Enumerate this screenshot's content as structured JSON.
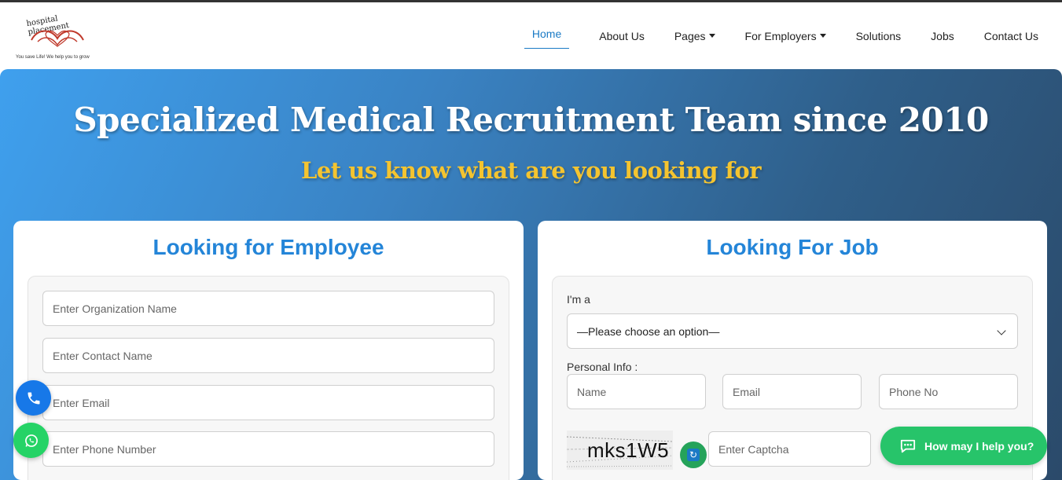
{
  "logo": {
    "title": "hospital placement",
    "tagline": "You save Life! We help you to grow"
  },
  "nav": {
    "items": [
      {
        "label": "Home",
        "active": true,
        "dropdown": false
      },
      {
        "label": "About Us",
        "active": false,
        "dropdown": false
      },
      {
        "label": "Pages",
        "active": false,
        "dropdown": true
      },
      {
        "label": "For Employers",
        "active": false,
        "dropdown": true
      },
      {
        "label": "Solutions",
        "active": false,
        "dropdown": false
      },
      {
        "label": "Jobs",
        "active": false,
        "dropdown": false
      },
      {
        "label": "Contact Us",
        "active": false,
        "dropdown": false
      }
    ]
  },
  "hero": {
    "title": "Specialized Medical Recruitment Team since 2010",
    "subtitle": "Let us know what are you looking for"
  },
  "employee_form": {
    "title": "Looking for Employee",
    "org_placeholder": "Enter Organization Name",
    "contact_placeholder": "Enter Contact Name",
    "email_placeholder": "Enter Email",
    "phone_placeholder": "Enter Phone Number"
  },
  "job_form": {
    "title": "Looking For Job",
    "role_label": "I'm a",
    "role_select_value": "—Please choose an option—",
    "personal_label": "Personal Info :",
    "name_placeholder": "Name",
    "email_placeholder": "Email",
    "phone_placeholder": "Phone No",
    "captcha_text": "mks1W5",
    "captcha_placeholder": "Enter Captcha"
  },
  "help_button": {
    "label": "How may I help you?"
  },
  "colors": {
    "accent": "#2485d8",
    "hero_subtitle": "#f4c430",
    "whatsapp": "#25d366",
    "phone_button": "#1778e8",
    "help_button": "#27c46a"
  },
  "icons": [
    "phone-icon",
    "whatsapp-icon",
    "chat-icon",
    "refresh-icon",
    "chevron-down-icon",
    "caret-down-icon"
  ]
}
